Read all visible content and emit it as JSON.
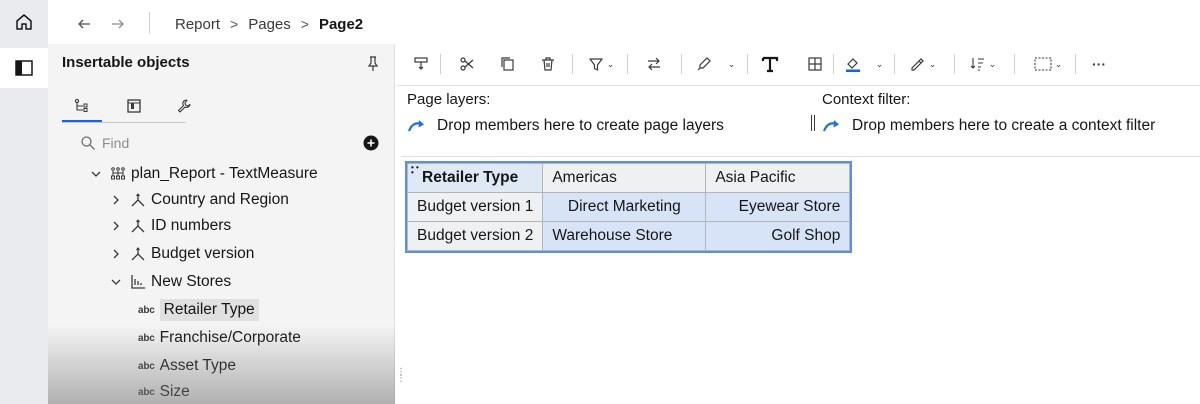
{
  "breadcrumb": {
    "items": [
      "Report",
      "Pages"
    ],
    "current": "Page2"
  },
  "panel": {
    "title": "Insertable objects",
    "tabs": [
      "source-tab",
      "toolbox-tab",
      "properties-tab"
    ],
    "search_placeholder": "Find",
    "tree": [
      {
        "label": "plan_Report - TextMeasure",
        "kind": "package",
        "level": 0,
        "expanded": true
      },
      {
        "label": "Country and Region",
        "kind": "dimension",
        "level": 1,
        "expanded": false
      },
      {
        "label": "ID numbers",
        "kind": "dimension",
        "level": 1,
        "expanded": false
      },
      {
        "label": "Budget version",
        "kind": "dimension",
        "level": 1,
        "expanded": false
      },
      {
        "label": "New Stores",
        "kind": "list",
        "level": 1,
        "expanded": true
      },
      {
        "label": "Retailer Type",
        "kind": "text",
        "level": 2,
        "selected": true
      },
      {
        "label": "Franchise/Corporate",
        "kind": "text",
        "level": 2
      },
      {
        "label": "Asset Type",
        "kind": "text",
        "level": 2
      },
      {
        "label": "Size",
        "kind": "text",
        "level": 2
      }
    ],
    "abc_tag": "abc"
  },
  "drop_zones": {
    "page_layers_label": "Page layers:",
    "page_layers_hint": "Drop members here to create page layers",
    "context_label": "Context filter:",
    "context_hint": "Drop members here to create a context filter"
  },
  "crosstab": {
    "corner": "Retailer Type",
    "columns": [
      "Americas",
      "Asia Pacific"
    ],
    "rows": [
      {
        "label": "Budget version 1",
        "cells": [
          "Direct Marketing",
          "Eyewear Store"
        ]
      },
      {
        "label": "Budget version 2",
        "cells": [
          "Warehouse Store",
          "Golf Shop"
        ]
      }
    ]
  },
  "toolbar": {
    "more_label": "···"
  },
  "colors": {
    "accent": "#0f62fe",
    "crosstab_border": "#5b8fe0",
    "cell_fill": "#d7e4f7"
  }
}
